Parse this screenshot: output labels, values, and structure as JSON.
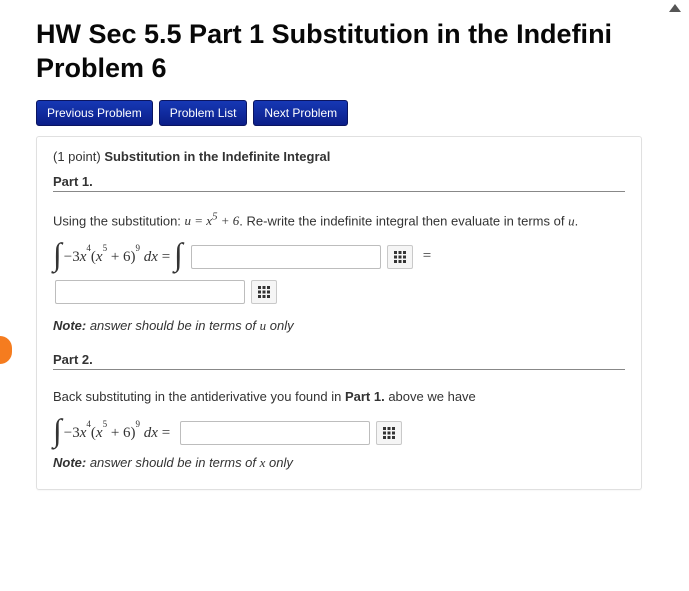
{
  "header": {
    "title": "HW Sec 5.5 Part 1 Substitution in the Indefini",
    "problem_label": "Problem 6"
  },
  "nav": {
    "prev": "Previous Problem",
    "list": "Problem List",
    "next": "Next Problem"
  },
  "meta": {
    "points_prefix": "(1 point) ",
    "points_title": "Substitution in the Indefinite Integral"
  },
  "part1": {
    "heading": "Part 1.",
    "intro_before": "Using the substitution: ",
    "substitution_plain": "u = x⁵ + 6",
    "intro_after": ". Re-write the indefinite integral then evaluate in terms of ",
    "intro_var": "u",
    "intro_period": ".",
    "integral_label": "−3x⁴(x⁵ + 6)⁹ dx = ",
    "equals": "=",
    "note_label": "Note:",
    "note_text": " answer should be in terms of ",
    "note_var": "u",
    "note_tail": " only"
  },
  "part2": {
    "heading": "Part 2.",
    "intro_before": "Back substituting in the antiderivative you found in ",
    "intro_bold": "Part 1.",
    "intro_after": " above we have",
    "integral_label": "−3x⁴(x⁵ + 6)⁹ dx = ",
    "note_label": "Note:",
    "note_text": " answer should be in terms of ",
    "note_var": "x",
    "note_tail": " only"
  },
  "inputs": {
    "p1_integrand": "",
    "p1_result": "",
    "p2_result": ""
  }
}
